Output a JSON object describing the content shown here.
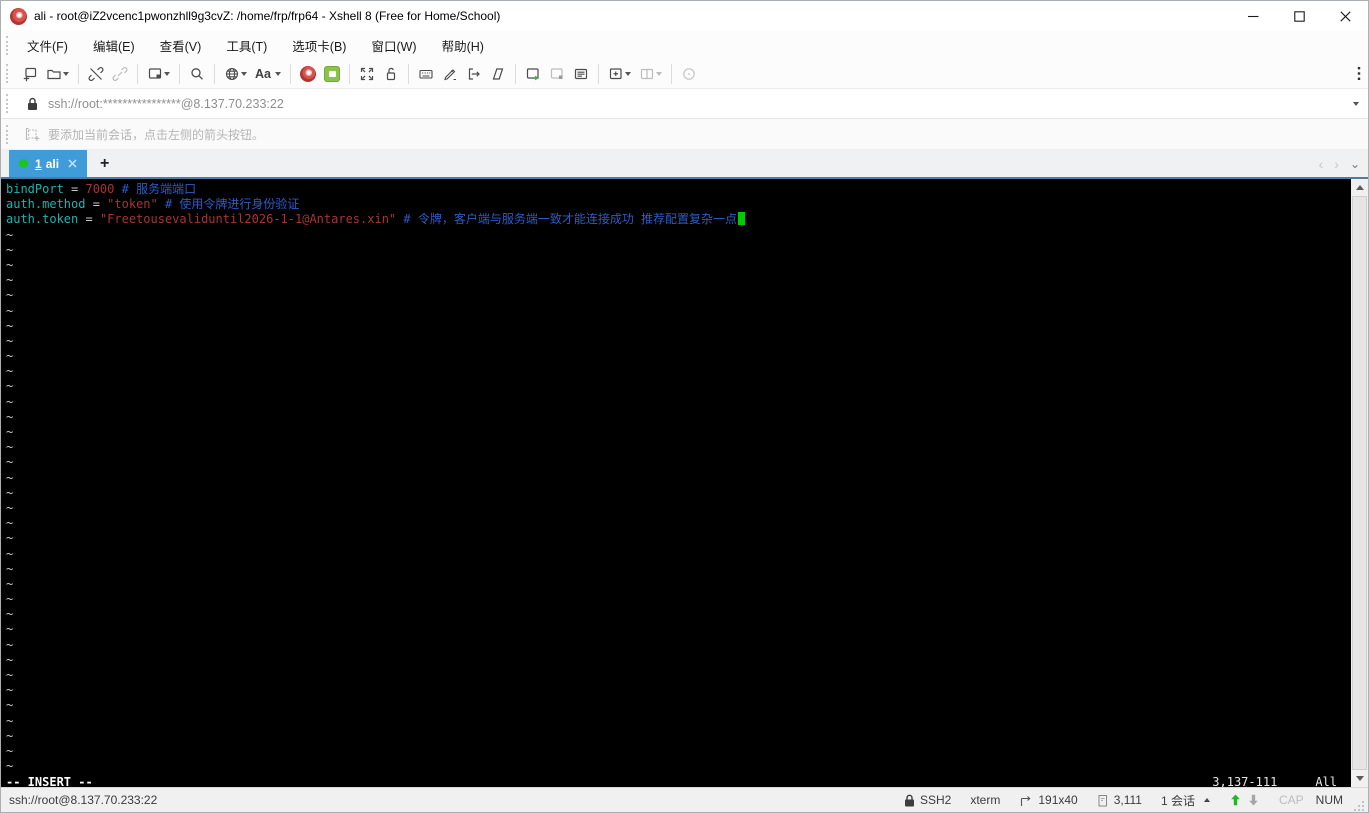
{
  "window": {
    "title": "ali - root@iZ2vcenc1pwonzhll9g3cvZ: /home/frp/frp64 - Xshell 8 (Free for Home/School)"
  },
  "menu": {
    "items": [
      {
        "label": "文件(F)"
      },
      {
        "label": "编辑(E)"
      },
      {
        "label": "查看(V)"
      },
      {
        "label": "工具(T)"
      },
      {
        "label": "选项卡(B)"
      },
      {
        "label": "窗口(W)"
      },
      {
        "label": "帮助(H)"
      }
    ]
  },
  "toolbar": {
    "font_glyph": "Aa",
    "icons": [
      "new-session",
      "open-session",
      "disconnect",
      "reconnect",
      "new-session-dialog",
      "find",
      "encoding-globe",
      "font",
      "xagent-logo",
      "xftp-logo",
      "fullscreen",
      "lock-screen",
      "compose-bar",
      "highlight-set",
      "logging",
      "run-script",
      "new-terminal",
      "duplicate-terminal",
      "session-properties-list",
      "new-window",
      "split-window",
      "refresh",
      "toolbar-overflow"
    ]
  },
  "glyphs": {
    "prev": "‹",
    "next": "›",
    "menu_caret": "⌄",
    "plus": "+"
  },
  "address": {
    "value": "ssh://root:****************@8.137.70.233:22"
  },
  "hint": {
    "text": "要添加当前会话，点击左侧的箭头按钮。"
  },
  "tabs": {
    "active": {
      "number": "1",
      "label": "ali"
    }
  },
  "terminal": {
    "lines": [
      {
        "segments": [
          {
            "t": "bindPort",
            "c": "key"
          },
          {
            "t": " = ",
            "c": "op"
          },
          {
            "t": "7000",
            "c": "val"
          },
          {
            "t": " # 服务端端口",
            "c": "comment"
          }
        ]
      },
      {
        "segments": [
          {
            "t": "auth.method",
            "c": "key"
          },
          {
            "t": " = ",
            "c": "op"
          },
          {
            "t": "\"token\"",
            "c": "val"
          },
          {
            "t": " # 使用令牌进行身份验证",
            "c": "comment"
          }
        ]
      },
      {
        "segments": [
          {
            "t": "auth.token",
            "c": "key"
          },
          {
            "t": " = ",
            "c": "op"
          },
          {
            "t": "\"Freetousevaliduntil2026-1-1@Antares.xin\"",
            "c": "val"
          },
          {
            "t": " # 令牌，客户端与服务端一致才能连接成功 推荐配置复杂一点",
            "c": "comment"
          }
        ]
      }
    ],
    "tilde": "~",
    "tilde_count": 36,
    "mode": "-- INSERT --",
    "ruler": "3,137-111",
    "scroll": "All",
    "colors": {
      "background": "#000000",
      "key": "#1fb2b2",
      "operator": "#c8c8c8",
      "value": "#a83434",
      "comment": "#2d5bc8",
      "tilde": "#c8c8c8",
      "cursor": "#00cc00"
    }
  },
  "statusbar": {
    "connection": "ssh://root@8.137.70.233:22",
    "protocol": "SSH2",
    "terminal_type": "xterm",
    "size": "191x40",
    "cursor_pos": "3,111",
    "sessions": "1 会话",
    "cap": "CAP",
    "num": "NUM"
  },
  "colors": {
    "tab_active": "#3f9cd8",
    "tab_dot": "#1ec41e",
    "tab_underline": "#4d7ba2",
    "titlebar_bg": "#ffffff",
    "statusbar_bg": "#f0f0f0"
  }
}
